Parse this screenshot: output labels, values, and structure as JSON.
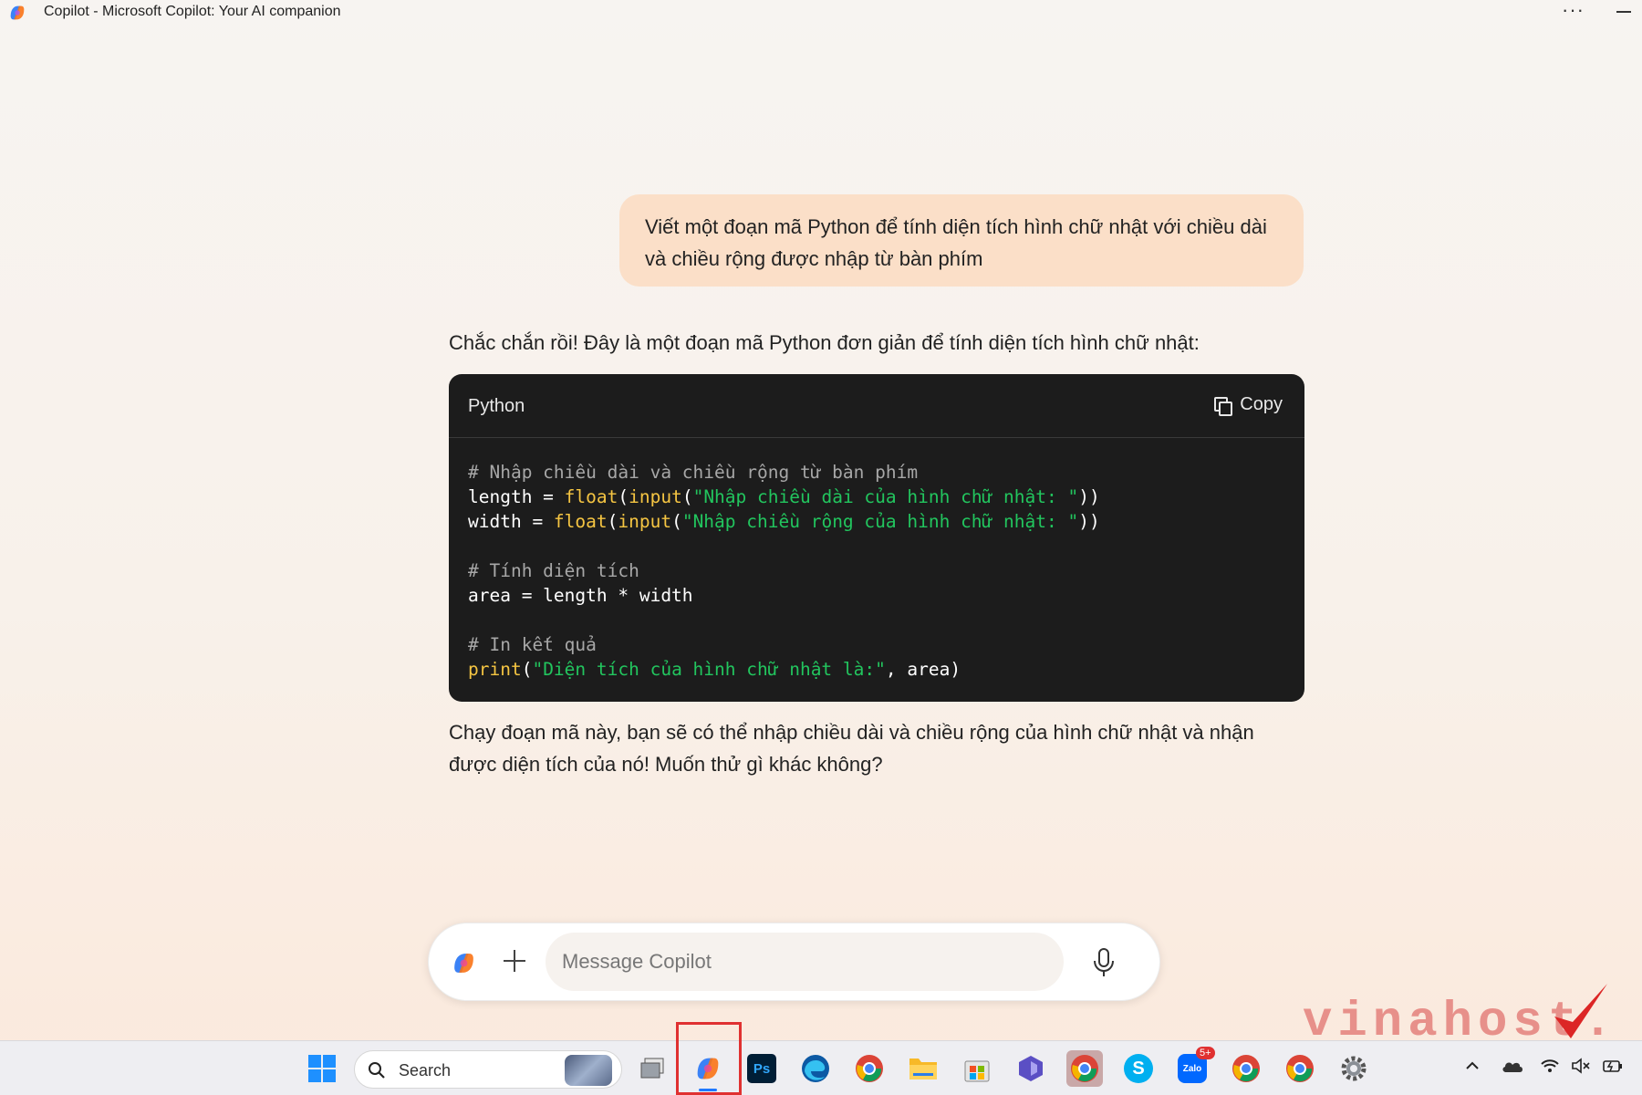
{
  "window": {
    "title": "Copilot - Microsoft Copilot: Your AI companion",
    "more_label": "···"
  },
  "conversation": {
    "user_message": "Viết một đoạn mã Python để tính diện tích hình chữ nhật với chiều dài và chiều rộng được nhập từ bàn phím",
    "assistant_intro": "Chắc chắn rồi! Đây là một đoạn mã Python đơn giản để tính diện tích hình chữ nhật:",
    "code_block": {
      "language": "Python",
      "copy_label": "Copy",
      "lines": [
        [
          {
            "t": "comment",
            "v": "# Nhập chiều dài và chiều rộng từ bàn phím"
          }
        ],
        [
          {
            "t": "plain",
            "v": "length = "
          },
          {
            "t": "fn",
            "v": "float"
          },
          {
            "t": "plain",
            "v": "("
          },
          {
            "t": "fn",
            "v": "input"
          },
          {
            "t": "plain",
            "v": "("
          },
          {
            "t": "str",
            "v": "\"Nhập chiều dài của hình chữ nhật: \""
          },
          {
            "t": "plain",
            "v": "))"
          }
        ],
        [
          {
            "t": "plain",
            "v": "width = "
          },
          {
            "t": "fn",
            "v": "float"
          },
          {
            "t": "plain",
            "v": "("
          },
          {
            "t": "fn",
            "v": "input"
          },
          {
            "t": "plain",
            "v": "("
          },
          {
            "t": "str",
            "v": "\"Nhập chiều rộng của hình chữ nhật: \""
          },
          {
            "t": "plain",
            "v": "))"
          }
        ],
        [],
        [
          {
            "t": "comment",
            "v": "# Tính diện tích"
          }
        ],
        [
          {
            "t": "plain",
            "v": "area = length * width"
          }
        ],
        [],
        [
          {
            "t": "comment",
            "v": "# In kết quả"
          }
        ],
        [
          {
            "t": "fn",
            "v": "print"
          },
          {
            "t": "plain",
            "v": "("
          },
          {
            "t": "str",
            "v": "\"Diện tích của hình chữ nhật là:\""
          },
          {
            "t": "plain",
            "v": ", area)"
          }
        ]
      ]
    },
    "assistant_outro": "Chạy đoạn mã này, bạn sẽ có thể nhập chiều dài và chiều rộng của hình chữ nhật và nhận được diện tích của nó! Muốn thử gì khác không?"
  },
  "composer": {
    "placeholder": "Message Copilot",
    "value": ""
  },
  "watermark": {
    "text": "vinahost."
  },
  "taskbar": {
    "search_label": "Search",
    "apps": [
      {
        "name": "task-view",
        "icon": "task-view-icon"
      },
      {
        "name": "copilot",
        "icon": "copilot-icon",
        "active": true
      },
      {
        "name": "photoshop",
        "icon": "photoshop-icon",
        "label": "Ps"
      },
      {
        "name": "edge",
        "icon": "edge-icon"
      },
      {
        "name": "chrome",
        "icon": "chrome-icon"
      },
      {
        "name": "file-explorer",
        "icon": "folder-icon"
      },
      {
        "name": "microsoft-store",
        "icon": "store-icon"
      },
      {
        "name": "app-purple",
        "icon": "app-icon"
      },
      {
        "name": "chrome-profile-1",
        "icon": "chrome-icon"
      },
      {
        "name": "skype",
        "icon": "skype-icon",
        "label": "S"
      },
      {
        "name": "zalo",
        "icon": "zalo-icon",
        "label": "Zalo",
        "badge": "5+"
      },
      {
        "name": "chrome-profile-2",
        "icon": "chrome-icon"
      },
      {
        "name": "chrome-profile-3",
        "icon": "chrome-icon"
      },
      {
        "name": "settings",
        "icon": "gear-icon"
      }
    ],
    "tray_icons": [
      "chevron-up-icon",
      "cloud-icon",
      "wifi-icon",
      "speaker-muted-icon",
      "battery-icon"
    ]
  },
  "colors": {
    "user_bubble": "#fbdfc8",
    "code_bg": "#1c1c1c",
    "code_comment": "#a7a7a7",
    "code_function": "#f5c542",
    "code_string": "#22c55e",
    "highlight_box": "#e03131"
  }
}
